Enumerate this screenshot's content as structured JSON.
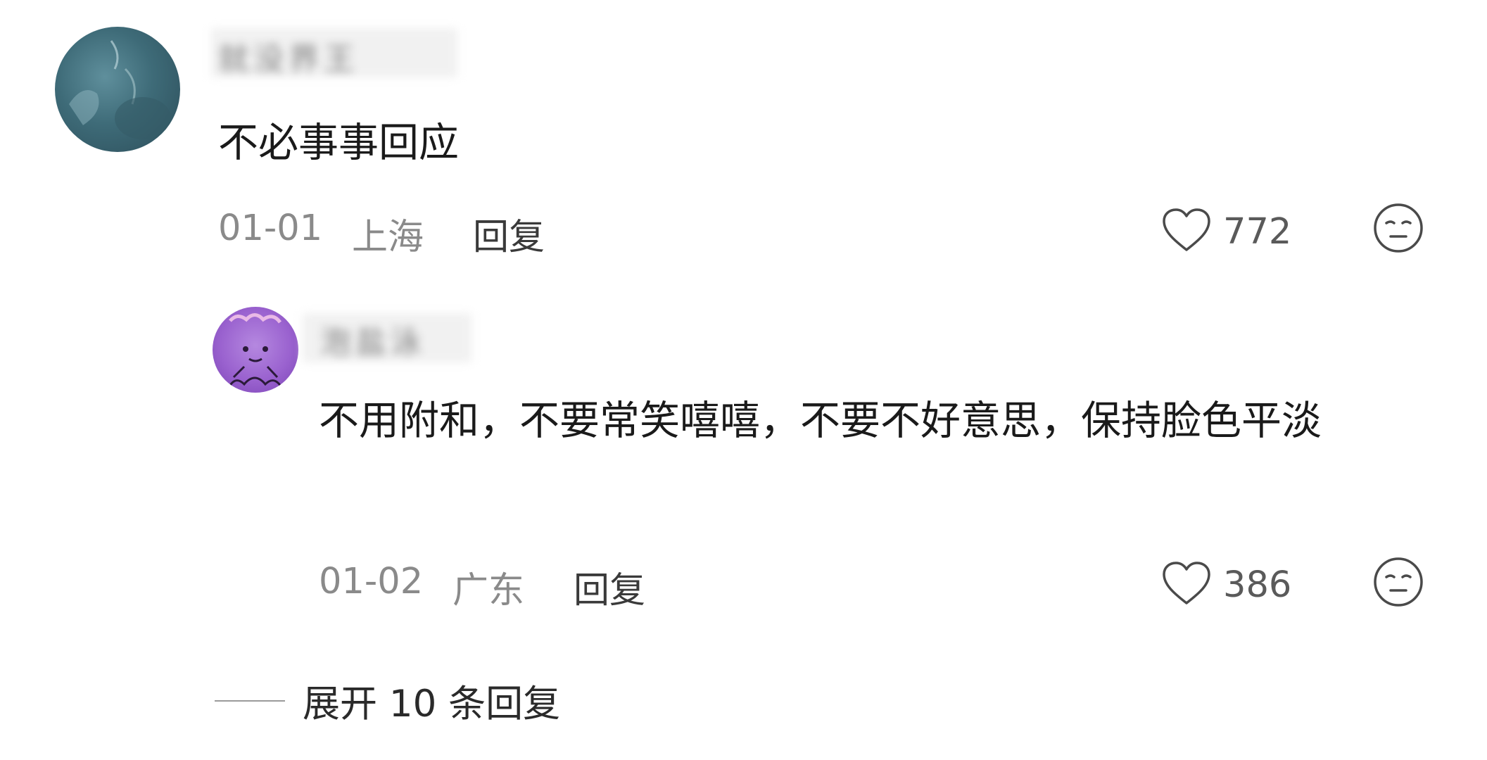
{
  "comment": {
    "username": "就没界王",
    "text": "不必事事回应",
    "date": "01-01",
    "location": "上海",
    "reply_label": "回复",
    "like_icon": "heart-outline-icon",
    "likes": "772",
    "reaction_icon": "neutral-face-icon"
  },
  "reply": {
    "username": "泡盐泳",
    "text": "不用附和，不要常笑嘻嘻，不要不好意思，保持脸色平淡",
    "date": "01-02",
    "location": "广东",
    "reply_label": "回复",
    "like_icon": "heart-outline-icon",
    "likes": "386",
    "reaction_icon": "neutral-face-icon"
  },
  "expand": {
    "label": "展开 10 条回复"
  },
  "colors": {
    "text_primary": "#1a1a1a",
    "text_meta": "#8a8a8a",
    "icon": "#4a4a4a"
  }
}
